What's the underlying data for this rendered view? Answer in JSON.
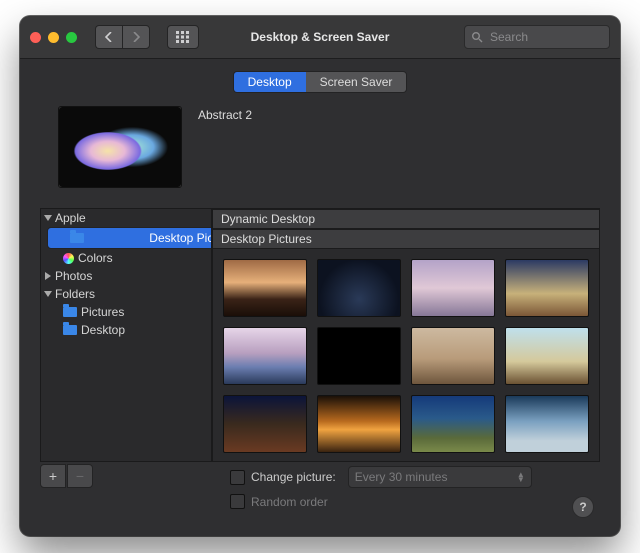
{
  "header": {
    "title": "Desktop & Screen Saver",
    "search_placeholder": "Search"
  },
  "tabs": [
    "Desktop",
    "Screen Saver"
  ],
  "current": {
    "name": "Abstract 2"
  },
  "sidebar": [
    {
      "label": "Apple",
      "expanded": true,
      "children": [
        {
          "label": "Desktop Pictures",
          "selected": true,
          "icon": "folder"
        },
        {
          "label": "Colors",
          "icon": "colors"
        }
      ]
    },
    {
      "label": "Photos",
      "expanded": false
    },
    {
      "label": "Folders",
      "expanded": true,
      "children": [
        {
          "label": "Pictures",
          "icon": "folder"
        },
        {
          "label": "Desktop",
          "icon": "folder"
        }
      ]
    }
  ],
  "content": {
    "sections": [
      "Dynamic Desktop",
      "Desktop Pictures"
    ]
  },
  "options": {
    "change_label": "Change picture:",
    "interval": "Every 30 minutes",
    "random_label": "Random order"
  }
}
